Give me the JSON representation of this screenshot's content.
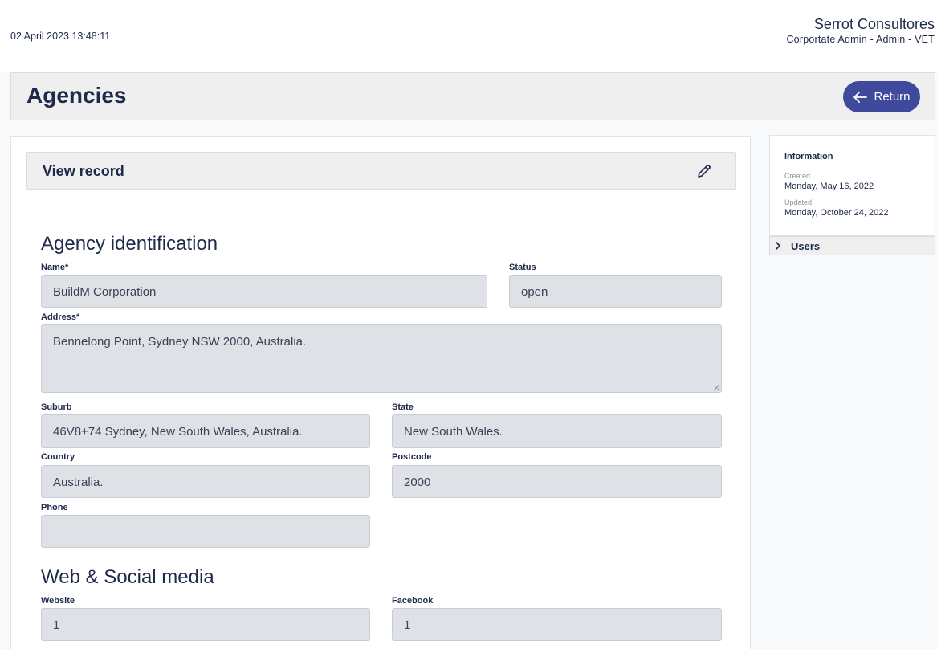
{
  "header": {
    "datetime": "02 April 2023 13:48:11",
    "company_name": "Serrot Consultores",
    "user_role": "Corportate Admin - Admin - VET"
  },
  "page": {
    "title": "Agencies",
    "return_label": "Return"
  },
  "record": {
    "title": "View record",
    "identification": {
      "heading": "Agency identification",
      "name_label": "Name*",
      "name_value": "BuildM Corporation",
      "status_label": "Status",
      "status_value": "open",
      "address_label": "Address*",
      "address_value": "Bennelong Point, Sydney NSW 2000, Australia.",
      "suburb_label": "Suburb",
      "suburb_value": "46V8+74 Sydney, New South Wales, Australia.",
      "state_label": "State",
      "state_value": "New South Wales.",
      "country_label": "Country",
      "country_value": "Australia.",
      "postcode_label": "Postcode",
      "postcode_value": "2000",
      "phone_label": "Phone",
      "phone_value": ""
    },
    "web": {
      "heading": "Web & Social media",
      "website_label": "Website",
      "website_value": "1",
      "facebook_label": "Facebook",
      "facebook_value": "1"
    }
  },
  "sidebar": {
    "info_title": "Information",
    "created_label": "Created",
    "created_value": "Monday, May 16, 2022",
    "updated_label": "Updated",
    "updated_value": "Monday, October 24, 2022",
    "users_label": "Users"
  },
  "colors": {
    "primary": "#3f4a9c",
    "text": "#1e2a4a",
    "field_bg": "#dee1e6",
    "header_bg": "#efefef"
  },
  "icons": {
    "return": "arrow-left-icon",
    "edit": "pencil-icon",
    "users_toggle": "chevron-right-icon"
  }
}
